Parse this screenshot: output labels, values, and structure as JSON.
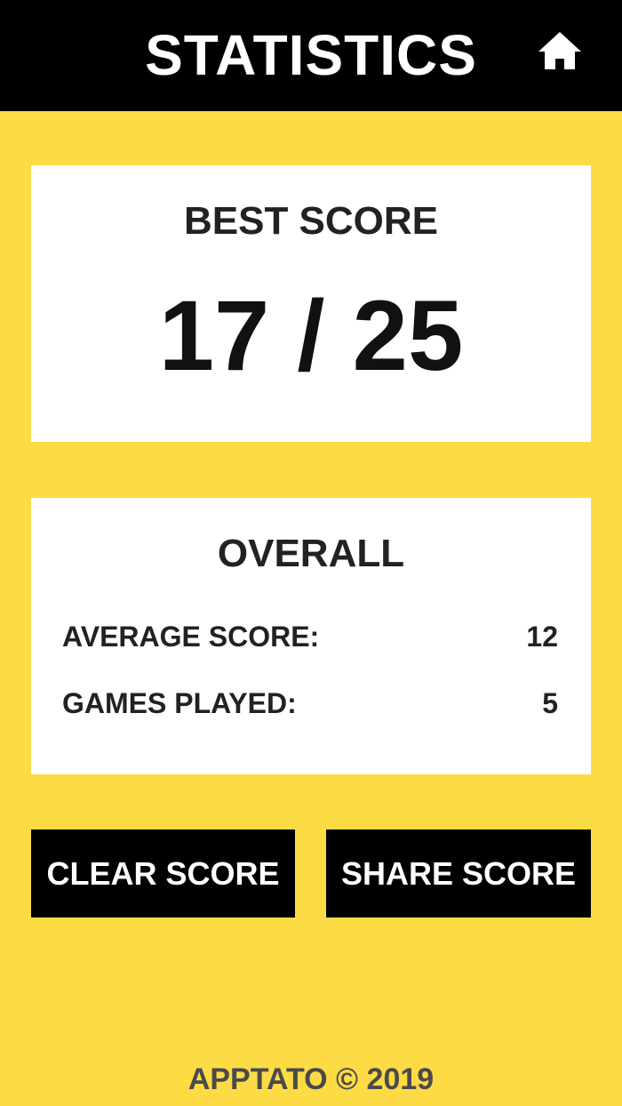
{
  "header": {
    "title": "STATISTICS",
    "home_icon": "home-icon"
  },
  "best_score": {
    "title": "BEST SCORE",
    "value": "17 / 25"
  },
  "overall": {
    "title": "OVERALL",
    "average_label": "AVERAGE SCORE:",
    "average_value": "12",
    "games_label": "GAMES PLAYED:",
    "games_value": "5"
  },
  "actions": {
    "clear_label": "CLEAR SCORE",
    "share_label": "SHARE SCORE"
  },
  "footer": {
    "text": "APPTATO © 2019"
  },
  "colors": {
    "background": "#FCDB45",
    "header": "#000000",
    "card": "#FFFFFF",
    "button": "#000000"
  }
}
